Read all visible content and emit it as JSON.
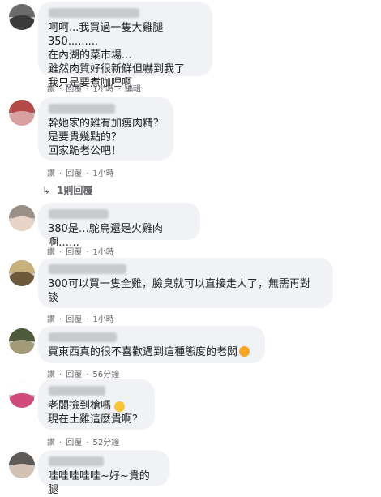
{
  "comments": [
    {
      "text": "呵呵...我買過一隻大雞腿350.........\n在內湖的菜市場...\n雖然肉質好很新鮮但嚇到我了\n我只是要煮咖哩啊",
      "like": "讚",
      "reply": "回覆",
      "time": "1小時",
      "extra": "編輯",
      "avatar_colors": [
        "#6b6b6b",
        "#3a3a3a"
      ]
    },
    {
      "text": "幹她家的雞有加瘦肉精？\n是要貴幾點的？\n回家跪老公吧！",
      "like": "讚",
      "reply": "回覆",
      "time": "1小時",
      "replies_label": "1則回覆",
      "avatar_colors": [
        "#b44a4a",
        "#d9a0a0"
      ]
    },
    {
      "text": "380是…鴕鳥還是火雞肉啊……",
      "like": "讚",
      "reply": "回覆",
      "time": "1小時",
      "avatar_colors": [
        "#9a8f86",
        "#e8d3c7"
      ]
    },
    {
      "text": "300可以買一隻全雞，臉臭就可以直接走人了，無需再對\n談",
      "like": "讚",
      "reply": "回覆",
      "time": "1小時",
      "avatar_colors": [
        "#c8b07a",
        "#6e5a3b"
      ]
    },
    {
      "text": "買東西真的很不喜歡遇到這種態度的老闆",
      "like": "讚",
      "reply": "回覆",
      "time": "56分鐘",
      "emoji": "angry-face",
      "emoji_color": "#f5a623",
      "avatar_colors": [
        "#4d5a3c",
        "#a39a7a"
      ]
    },
    {
      "text": "老闆撿到槍嗎\n現在土雞這麼貴啊？",
      "like": "讚",
      "reply": "回覆",
      "time": "52分鐘",
      "emoji": "crazy-face",
      "emoji_color": "#f7c531",
      "avatar_colors": [
        "#ffffff",
        "#d14a7c"
      ]
    },
    {
      "text": "哇哇哇哇哇~好~貴的腿",
      "avatar_colors": [
        "#5d5a57",
        "#d2c1b4"
      ]
    }
  ]
}
